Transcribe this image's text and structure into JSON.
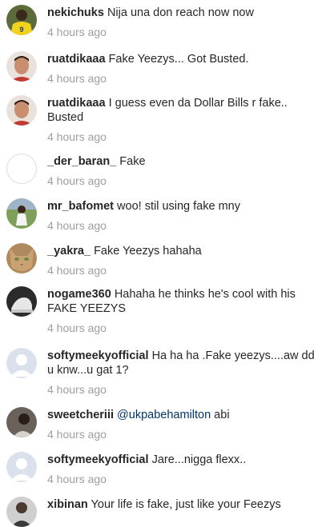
{
  "comments": [
    {
      "username": "nekichuks",
      "text": "Nija una don reach now now",
      "mention": "",
      "time": "4 hours ago",
      "avatar": "jersey"
    },
    {
      "username": "ruatdikaaa",
      "text": "Fake Yeezys... Got Busted.",
      "mention": "",
      "time": "4 hours ago",
      "avatar": "face"
    },
    {
      "username": "ruatdikaaa",
      "text": "I guess even da Dollar Bills r fake.. Busted",
      "mention": "",
      "time": "4 hours ago",
      "avatar": "face"
    },
    {
      "username": "_der_baran_",
      "text": "Fake",
      "mention": "",
      "time": "4 hours ago",
      "avatar": "blank"
    },
    {
      "username": "mr_bafomet",
      "text": "woo! stil using fake mny",
      "mention": "",
      "time": "4 hours ago",
      "avatar": "field"
    },
    {
      "username": "_yakra_",
      "text": "Fake Yeezys hahaha",
      "mention": "",
      "time": "4 hours ago",
      "avatar": "cat"
    },
    {
      "username": "nogame360",
      "text": "Hahaha he thinks he's cool with his FAKE YEEZYS",
      "mention": "",
      "time": "4 hours ago",
      "avatar": "shoe"
    },
    {
      "username": "softymeekyofficial",
      "text": "Ha ha ha .Fake yeezys....aw dd u knw...u gat 1?",
      "mention": "",
      "time": "4 hours ago",
      "avatar": "default"
    },
    {
      "username": "sweetcheriii",
      "text": " abi",
      "mention": "@ukpabehamilton",
      "time": "4 hours ago",
      "avatar": "dark"
    },
    {
      "username": "softymeekyofficial",
      "text": "Jare...nigga flexx..",
      "mention": "",
      "time": "4 hours ago",
      "avatar": "default"
    },
    {
      "username": "xibinan",
      "text": "Your life is fake, just like your Feezys",
      "mention": "",
      "time": "",
      "avatar": "person"
    }
  ]
}
